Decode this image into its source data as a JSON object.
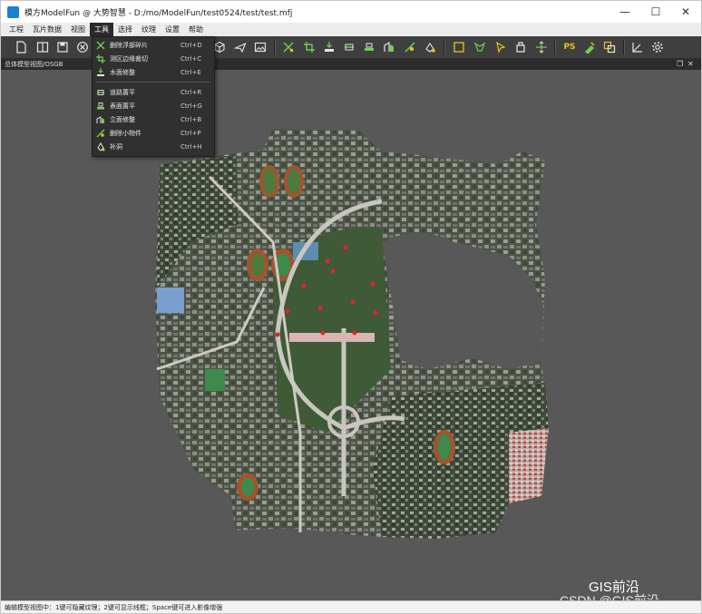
{
  "window": {
    "title": "模方ModelFun @ 大势智慧 - D:/mo/ModelFun/test0524/test/test.mfj",
    "minimize_glyph": "—",
    "maximize_glyph": "☐",
    "close_glyph": "✕"
  },
  "menubar": {
    "items": [
      {
        "label": "工程"
      },
      {
        "label": "瓦片数据"
      },
      {
        "label": "视图"
      },
      {
        "label": "工具"
      },
      {
        "label": "选择"
      },
      {
        "label": "纹理"
      },
      {
        "label": "设置"
      },
      {
        "label": "帮助"
      }
    ],
    "active_index": 3
  },
  "tools_menu": {
    "items": [
      {
        "label": "删除浮部碎片",
        "shortcut": "Ctrl+D",
        "icon": "delete-fragments-icon"
      },
      {
        "label": "测区边缘裁切",
        "shortcut": "Ctrl+C",
        "icon": "edge-crop-icon"
      },
      {
        "label": "水面修整",
        "shortcut": "Ctrl+E",
        "icon": "water-surface-icon"
      },
      {
        "label": "道路置平",
        "shortcut": "Ctrl+R",
        "icon": "road-flatten-icon"
      },
      {
        "label": "表面置平",
        "shortcut": "Ctrl+G",
        "icon": "surface-flatten-icon"
      },
      {
        "label": "立面修整",
        "shortcut": "Ctrl+B",
        "icon": "facade-repair-icon"
      },
      {
        "label": "删除小物件",
        "shortcut": "Ctrl+P",
        "icon": "remove-small-object-icon"
      },
      {
        "label": "补洞",
        "shortcut": "Ctrl+H",
        "icon": "fill-hole-icon"
      }
    ]
  },
  "toolbar": {
    "ps_label": "PS"
  },
  "panel": {
    "title": "总体模型视图/OSGB",
    "restore_glyph": "❐",
    "close_glyph": "✕"
  },
  "statusbar": {
    "text": "编辑模型视图中：1键可隐藏纹理；2键可显示线框；Space键可进入影像增强"
  },
  "watermarks": {
    "gis": "GIS前沿",
    "csdn": "CSDN @GIS前沿"
  },
  "colors": {
    "menu_active_bg": "#2b2b2b",
    "toolbar_bg": "#3f3f3f",
    "viewport_bg": "#585858",
    "icon_green": "#6ccf4f",
    "icon_yellow": "#e8c21c",
    "marker_red": "#e0262a"
  }
}
